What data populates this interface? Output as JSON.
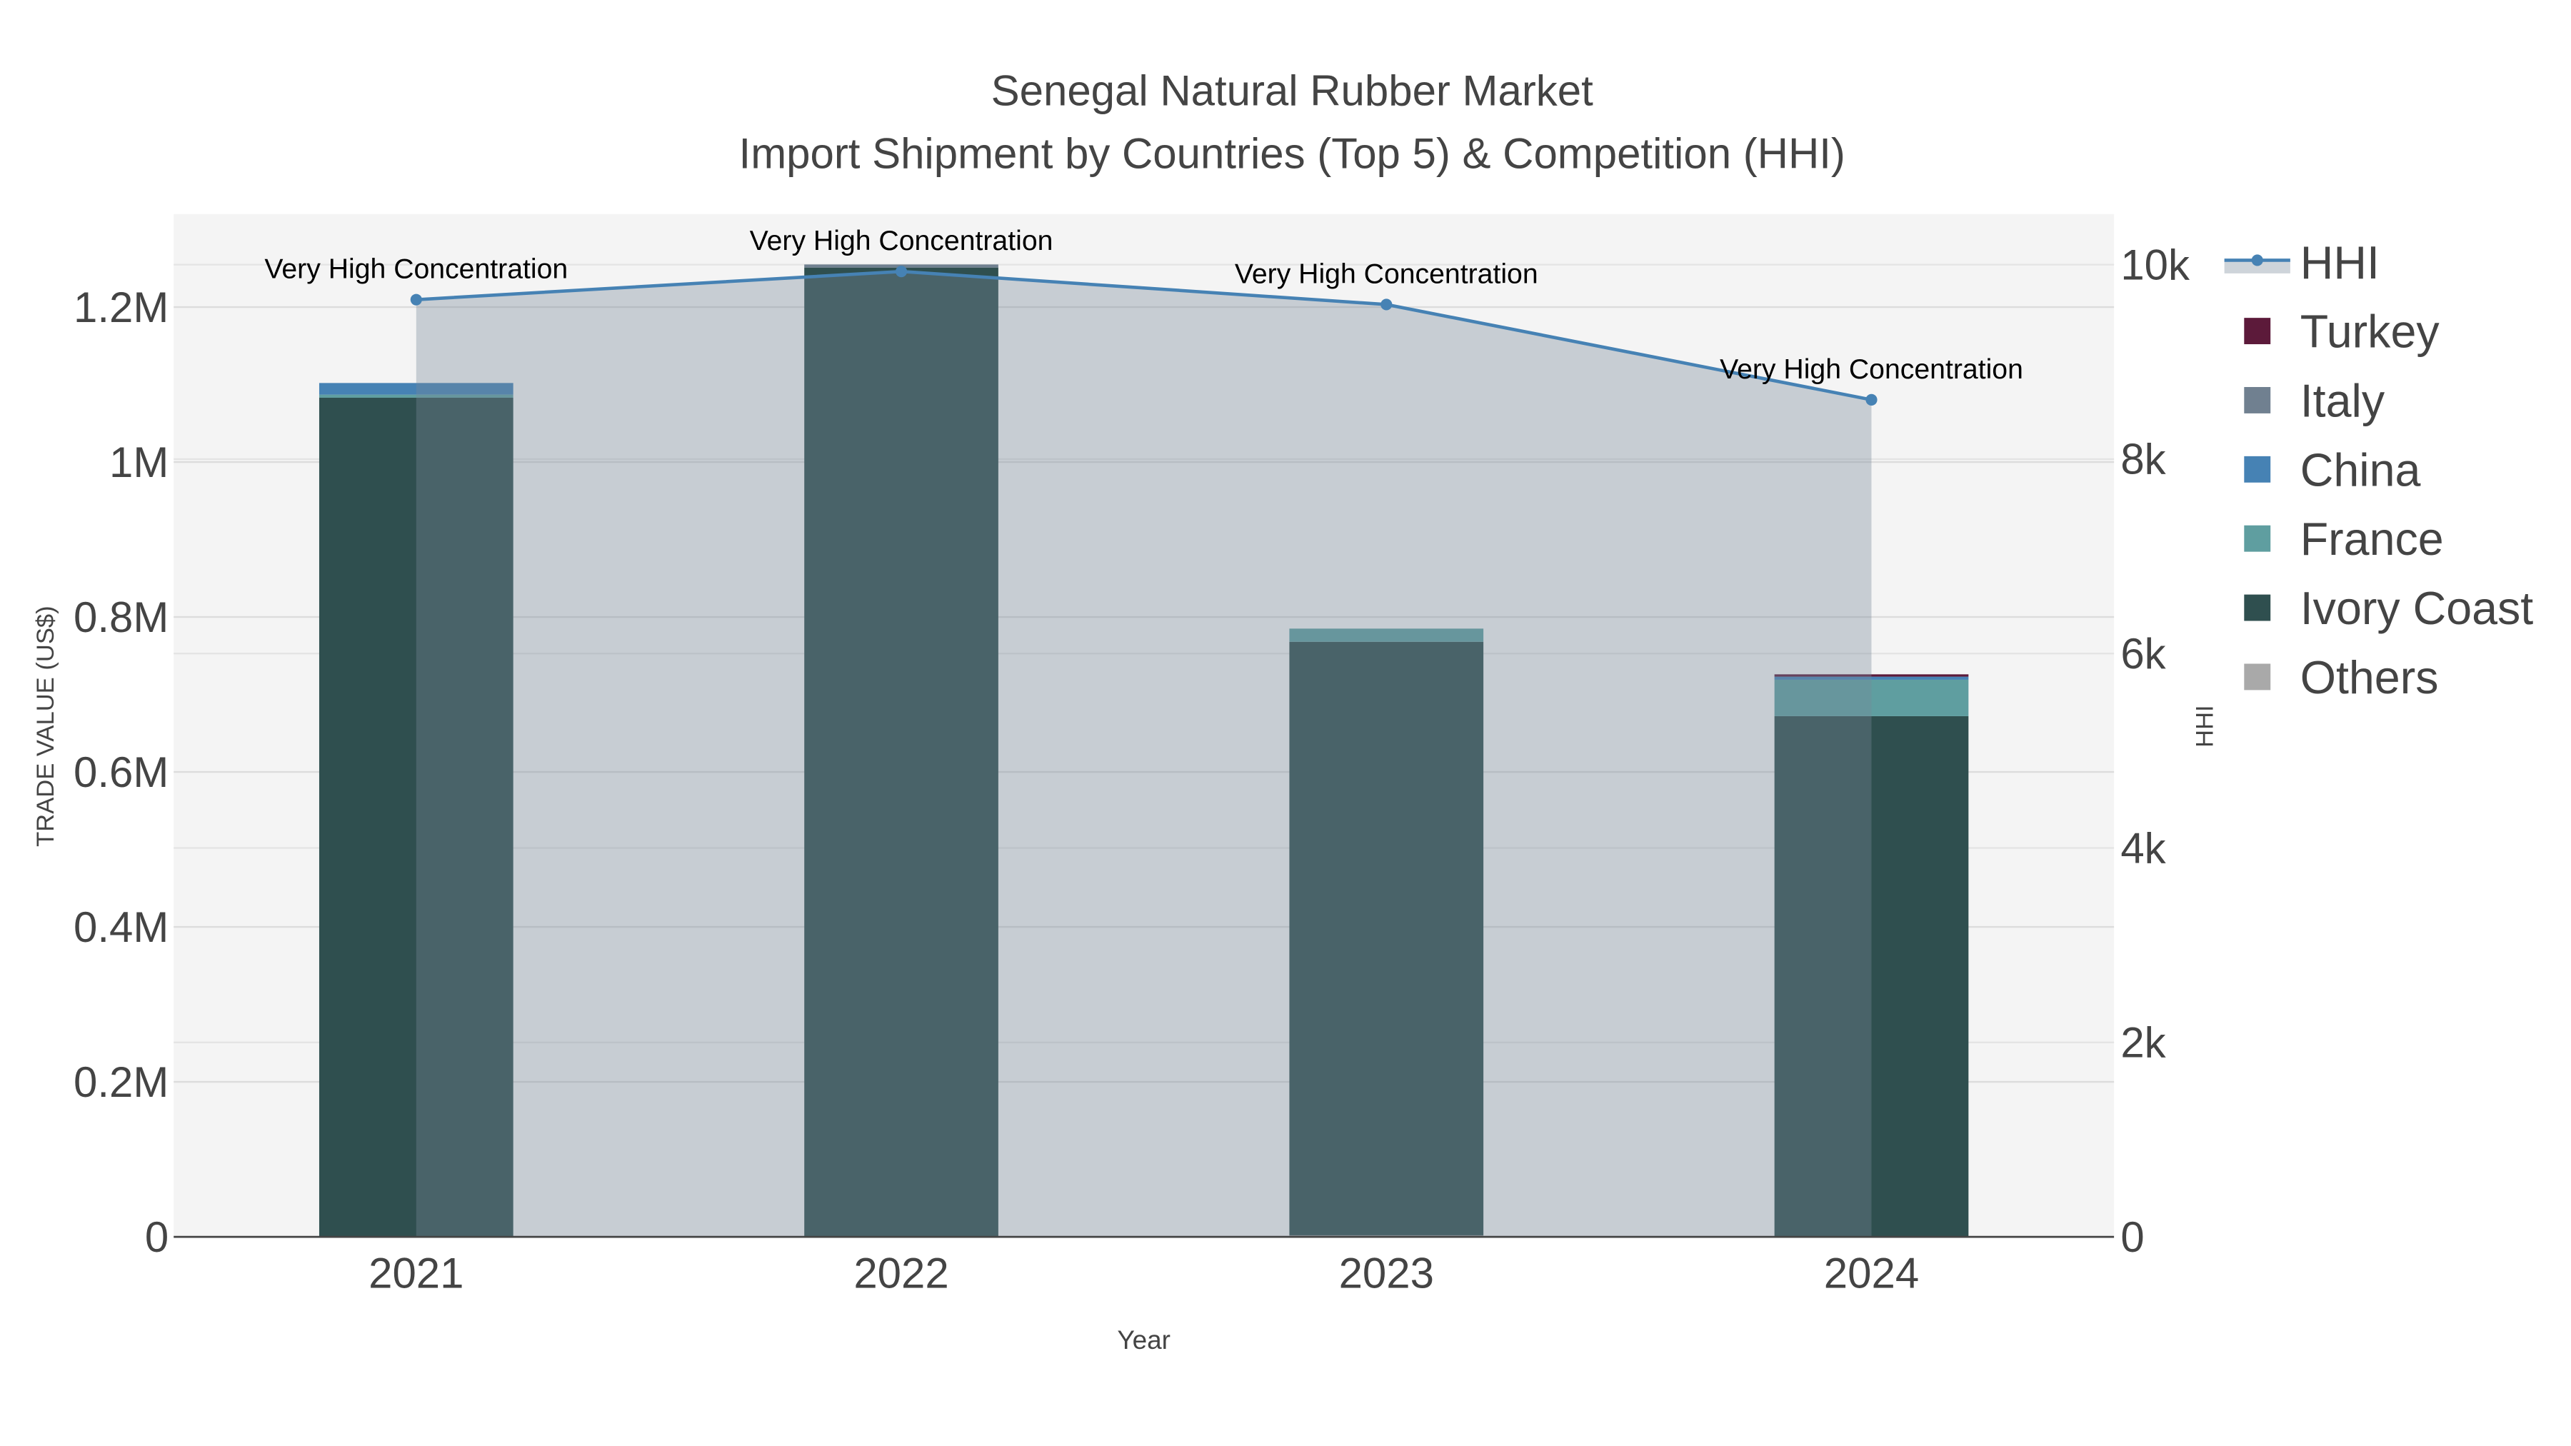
{
  "chart_data": {
    "type": "bar",
    "title": "Senegal Natural Rubber Market",
    "subtitle": "Import Shipment by Countries (Top 5) & Competition (HHI)",
    "xlabel": "Year",
    "ylabel": "TRADE VALUE (US$)",
    "y2label": "HHI",
    "categories": [
      "2021",
      "2022",
      "2023",
      "2024"
    ],
    "ylim": [
      0,
      1320000
    ],
    "y2lim": [
      0,
      10520
    ],
    "yticks": [
      {
        "v": 0,
        "label": "0"
      },
      {
        "v": 200000,
        "label": "0.2M"
      },
      {
        "v": 400000,
        "label": "0.4M"
      },
      {
        "v": 600000,
        "label": "0.6M"
      },
      {
        "v": 800000,
        "label": "0.8M"
      },
      {
        "v": 1000000,
        "label": "1M"
      },
      {
        "v": 1200000,
        "label": "1.2M"
      }
    ],
    "y2ticks": [
      {
        "v": 0,
        "label": "0"
      },
      {
        "v": 2000,
        "label": "2k"
      },
      {
        "v": 4000,
        "label": "4k"
      },
      {
        "v": 6000,
        "label": "6k"
      },
      {
        "v": 8000,
        "label": "8k"
      },
      {
        "v": 10000,
        "label": "10k"
      }
    ],
    "barmode": "stack",
    "series": [
      {
        "name": "Others",
        "color": "#a9a9a9",
        "values": [
          0,
          0,
          2000,
          0
        ]
      },
      {
        "name": "Ivory Coast",
        "color": "#2f4f4f",
        "values": [
          1083000,
          1251000,
          766000,
          672000
        ]
      },
      {
        "name": "France",
        "color": "#5f9ea0",
        "values": [
          4000,
          0,
          17000,
          47000
        ]
      },
      {
        "name": "China",
        "color": "#4682b4",
        "values": [
          15000,
          0,
          0,
          4000
        ]
      },
      {
        "name": "Italy",
        "color": "#708090",
        "values": [
          0,
          4000,
          0,
          0
        ]
      },
      {
        "name": "Turkey",
        "color": "#5c1a3a",
        "values": [
          0,
          0,
          0,
          3000
        ]
      }
    ],
    "hhi": {
      "name": "HHI",
      "color": "#4682b4",
      "values": [
        9640,
        9930,
        9590,
        8610
      ],
      "annotations": [
        "Very High Concentration",
        "Very High Concentration",
        "Very High Concentration",
        "Very High Concentration"
      ]
    },
    "legend": [
      "HHI",
      "Turkey",
      "Italy",
      "China",
      "France",
      "Ivory Coast",
      "Others"
    ],
    "legend_position": "right",
    "grid": true
  }
}
